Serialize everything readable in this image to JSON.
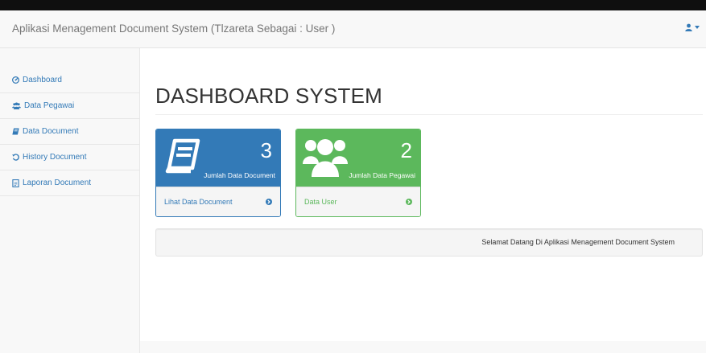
{
  "navbar": {
    "brand": "Aplikasi Menagement Document System (Tlzareta Sebagai : User )",
    "user_icon": "user-icon",
    "caret_icon": "caret-down-icon"
  },
  "sidebar": {
    "items": [
      {
        "label": "Dashboard",
        "icon": "dashboard-icon"
      },
      {
        "label": "Data Pegawai",
        "icon": "users-icon"
      },
      {
        "label": "Data Document",
        "icon": "book-icon"
      },
      {
        "label": "History Document",
        "icon": "history-icon"
      },
      {
        "label": "Laporan Document",
        "icon": "report-icon"
      }
    ]
  },
  "main": {
    "title": "DASHBOARD SYSTEM",
    "panels": [
      {
        "count": "3",
        "label": "Jumlah Data Document",
        "link": "Lihat Data Document",
        "icon": "book-icon",
        "color": "#337ab7"
      },
      {
        "count": "2",
        "label": "Jumlah Data Pegawai",
        "link": "Data User",
        "icon": "users-icon",
        "color": "#5cb85c"
      }
    ],
    "welcome": "Selamat Datang Di Aplikasi Menagement Document System"
  }
}
